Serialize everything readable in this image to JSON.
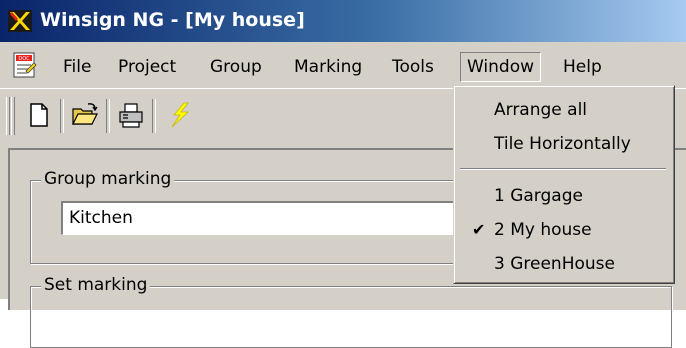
{
  "window": {
    "title": "Winsign NG - [My house]"
  },
  "menubar": {
    "items": [
      {
        "label": "File"
      },
      {
        "label": "Project"
      },
      {
        "label": "Group"
      },
      {
        "label": "Marking"
      },
      {
        "label": "Tools"
      },
      {
        "label": "Window"
      },
      {
        "label": "Help"
      }
    ]
  },
  "toolbar": {
    "buttons": [
      {
        "icon": "new-document-icon"
      },
      {
        "icon": "open-folder-icon"
      },
      {
        "icon": "print-icon"
      },
      {
        "icon": "lightning-icon"
      }
    ]
  },
  "main": {
    "group_marking": {
      "label": "Group marking",
      "value": "Kitchen"
    },
    "set_marking": {
      "label": "Set marking"
    }
  },
  "window_menu": {
    "items": [
      {
        "label": "Arrange all"
      },
      {
        "label": "Tile Horizontally"
      },
      {
        "label": "1 Gargage"
      },
      {
        "label": "2 My house",
        "checked": true
      },
      {
        "label": "3 GreenHouse"
      }
    ]
  },
  "colors": {
    "title_bar": "#0a246a",
    "title_bar_end": "#a6caf0",
    "face": "#d4d0c8",
    "lightning": "#ffff00"
  }
}
